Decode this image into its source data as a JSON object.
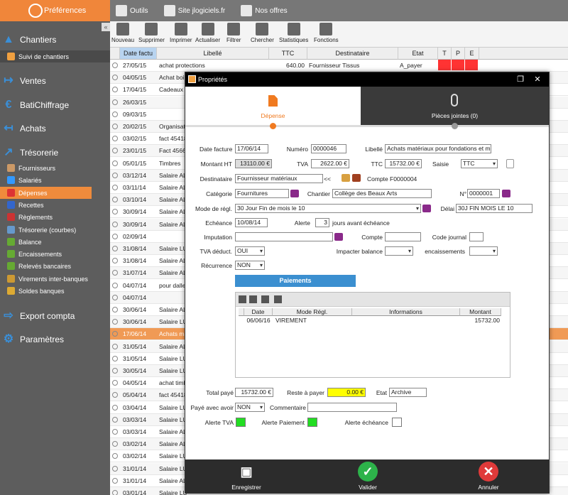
{
  "sidebar": {
    "app_title": "Préférences",
    "collapse": "«",
    "sections": [
      {
        "label": "Chantiers",
        "icon": "construction-cone-icon",
        "glyph": "▲"
      },
      {
        "label": "Ventes",
        "icon": "exit-arrow-icon",
        "glyph": "↦"
      },
      {
        "label": "BatiChiffrage",
        "icon": "euro-icon",
        "glyph": "€"
      },
      {
        "label": "Achats",
        "icon": "enter-arrow-icon",
        "glyph": "↤"
      },
      {
        "label": "Trésorerie",
        "icon": "trend-chart-icon",
        "glyph": "↗"
      },
      {
        "label": "Export compta",
        "icon": "export-icon",
        "glyph": "⇨"
      },
      {
        "label": "Paramètres",
        "icon": "gear-icon",
        "glyph": "⚙"
      }
    ],
    "chantiers_items": [
      "Suivi de chantiers"
    ],
    "tresorerie_items": [
      "Fournisseurs",
      "Salariés",
      "Dépenses",
      "Recettes",
      "Règlements",
      "Trésorerie (courbes)",
      "Balance",
      "Encaissements",
      "Relevés bancaires",
      "Virements inter-banques",
      "Soldes banques"
    ]
  },
  "topbar": {
    "outils": "Outils",
    "site": "Site jlogiciels.fr",
    "offres": "Nos offres"
  },
  "toolbar": [
    "Nouveau",
    "Supprimer",
    "Imprimer",
    "Actualiser",
    "Filtrer",
    "Chercher",
    "Statistiques",
    "Fonctions"
  ],
  "grid": {
    "headers": [
      "Date factu",
      "Libellé",
      "TTC",
      "Destinataire",
      "Etat",
      "T",
      "P",
      "E"
    ],
    "rows": [
      {
        "date": "27/05/15",
        "lib": "achat protections",
        "ttc": "640.00",
        "dest": "Fournisseur Tissus",
        "etat": "A_payer"
      },
      {
        "date": "04/05/15",
        "lib": "Achat bois",
        "ttc": "",
        "dest": "",
        "etat": ""
      },
      {
        "date": "17/04/15",
        "lib": "Cadeaux C",
        "ttc": "",
        "dest": "",
        "etat": ""
      },
      {
        "date": "26/03/15",
        "lib": "",
        "ttc": "",
        "dest": "",
        "etat": ""
      },
      {
        "date": "09/03/15",
        "lib": "",
        "ttc": "",
        "dest": "",
        "etat": ""
      },
      {
        "date": "20/02/15",
        "lib": "Organisati",
        "ttc": "",
        "dest": "",
        "etat": ""
      },
      {
        "date": "03/02/15",
        "lib": "fact 45418",
        "ttc": "",
        "dest": "",
        "etat": ""
      },
      {
        "date": "23/01/15",
        "lib": "Fact 4566",
        "ttc": "",
        "dest": "",
        "etat": ""
      },
      {
        "date": "05/01/15",
        "lib": "Timbres",
        "ttc": "",
        "dest": "",
        "etat": ""
      },
      {
        "date": "03/12/14",
        "lib": "Salaire AL",
        "ttc": "",
        "dest": "",
        "etat": ""
      },
      {
        "date": "03/11/14",
        "lib": "Salaire AL",
        "ttc": "",
        "dest": "",
        "etat": ""
      },
      {
        "date": "03/10/14",
        "lib": "Salaire AL",
        "ttc": "",
        "dest": "",
        "etat": ""
      },
      {
        "date": "30/09/14",
        "lib": "Salaire AL",
        "ttc": "",
        "dest": "",
        "etat": ""
      },
      {
        "date": "30/09/14",
        "lib": "Salaire AL",
        "ttc": "",
        "dest": "",
        "etat": ""
      },
      {
        "date": "02/09/14",
        "lib": "",
        "ttc": "",
        "dest": "",
        "etat": ""
      },
      {
        "date": "31/08/14",
        "lib": "Salaire LU",
        "ttc": "",
        "dest": "",
        "etat": ""
      },
      {
        "date": "31/08/14",
        "lib": "Salaire AL",
        "ttc": "",
        "dest": "",
        "etat": ""
      },
      {
        "date": "31/07/14",
        "lib": "Salaire AL",
        "ttc": "",
        "dest": "",
        "etat": ""
      },
      {
        "date": "04/07/14",
        "lib": "pour dalle",
        "ttc": "",
        "dest": "",
        "etat": ""
      },
      {
        "date": "04/07/14",
        "lib": "",
        "ttc": "",
        "dest": "",
        "etat": ""
      },
      {
        "date": "30/06/14",
        "lib": "Salaire AL",
        "ttc": "",
        "dest": "",
        "etat": ""
      },
      {
        "date": "30/06/14",
        "lib": "Salaire LU",
        "ttc": "",
        "dest": "",
        "etat": ""
      },
      {
        "date": "17/06/14",
        "lib": "Achats ma",
        "ttc": "",
        "dest": "",
        "etat": ""
      },
      {
        "date": "31/05/14",
        "lib": "Salaire AL",
        "ttc": "",
        "dest": "",
        "etat": ""
      },
      {
        "date": "31/05/14",
        "lib": "Salaire LU",
        "ttc": "",
        "dest": "",
        "etat": ""
      },
      {
        "date": "30/05/14",
        "lib": "Salaire LU",
        "ttc": "",
        "dest": "",
        "etat": ""
      },
      {
        "date": "04/05/14",
        "lib": "achat timb",
        "ttc": "",
        "dest": "",
        "etat": ""
      },
      {
        "date": "05/04/14",
        "lib": "fact 45418",
        "ttc": "",
        "dest": "",
        "etat": ""
      },
      {
        "date": "03/04/14",
        "lib": "Salaire LU",
        "ttc": "",
        "dest": "",
        "etat": ""
      },
      {
        "date": "03/03/14",
        "lib": "Salaire LU",
        "ttc": "",
        "dest": "",
        "etat": ""
      },
      {
        "date": "03/03/14",
        "lib": "Salaire AL",
        "ttc": "",
        "dest": "",
        "etat": ""
      },
      {
        "date": "03/02/14",
        "lib": "Salaire AL",
        "ttc": "",
        "dest": "",
        "etat": ""
      },
      {
        "date": "03/02/14",
        "lib": "Salaire LU",
        "ttc": "",
        "dest": "",
        "etat": ""
      },
      {
        "date": "31/01/14",
        "lib": "Salaire LU",
        "ttc": "",
        "dest": "",
        "etat": ""
      },
      {
        "date": "31/01/14",
        "lib": "Salaire AL",
        "ttc": "",
        "dest": "",
        "etat": ""
      },
      {
        "date": "03/01/14",
        "lib": "Salaire LU",
        "ttc": "",
        "dest": "",
        "etat": ""
      }
    ]
  },
  "dialog": {
    "title": "Propriétés",
    "tab_depense": "Dépense",
    "tab_pieces": "Pièces jointes (0)",
    "labels": {
      "date": "Date facture",
      "numero": "Numéro",
      "libelle": "Libellé",
      "ht": "Montant HT",
      "tva": "TVA",
      "ttc": "TTC",
      "saisie": "Saisie",
      "destinataire": "Destinataire",
      "compte": "Compte",
      "categorie": "Catégorie",
      "chantier": "Chantier",
      "no": "N°",
      "mode": "Mode de régl.",
      "delai": "Délai",
      "echeance": "Echéance",
      "alerte": "Alerte",
      "jours": "jours avant échéance",
      "imputation": "Imputation",
      "compte2": "Compte",
      "journal": "Code journal",
      "tvadeduct": "TVA déduct.",
      "impacter": "Impacter balance",
      "encaissements": "encaissements",
      "recurrence": "Récurrence",
      "total": "Total payé",
      "reste": "Reste à payer",
      "etat": "Etat",
      "avoir": "Payé avec avoir",
      "commentaire": "Commentaire",
      "alerte_tva": "Alerte TVA",
      "alerte_paiement": "Alerte Paiement",
      "alerte_echeance": "Alerte échéance"
    },
    "values": {
      "date": "17/06/14",
      "numero": "0000046",
      "libelle": "Achats matériaux pour fondations et mur",
      "ht": "13110.00 €",
      "tva": "2622.00 €",
      "ttc": "15732.00 €",
      "saisie": "TTC",
      "destinataire": "Fournisseur matériaux",
      "arrows": "<<",
      "compte": "F0000004",
      "categorie": "Fournitures",
      "chantier": "Collège des Beaux Arts",
      "no": "0000001",
      "mode": "30 Jour Fin de mois le 10",
      "delai": "30J FIN MOIS LE 10",
      "echeance": "10/08/14",
      "alerte": "3",
      "imputation": "",
      "compte2": "",
      "journal": "",
      "tvadeduct": "OUI",
      "impacter": "",
      "encaissements": "",
      "recurrence": "NON",
      "total": "15732.00 €",
      "reste": "0.00 €",
      "etat": "Archive",
      "avoir": "NON",
      "commentaire": ""
    },
    "paiements": {
      "title": "Paiements",
      "headers": [
        "Date",
        "Mode Régl.",
        "Informations",
        "Montant"
      ],
      "rows": [
        {
          "date": "06/06/16",
          "mode": "VIREMENT",
          "info": "",
          "montant": "15732.00"
        }
      ]
    },
    "footer": {
      "save": "Enregistrer",
      "ok": "Valider",
      "cancel": "Annuler"
    }
  }
}
